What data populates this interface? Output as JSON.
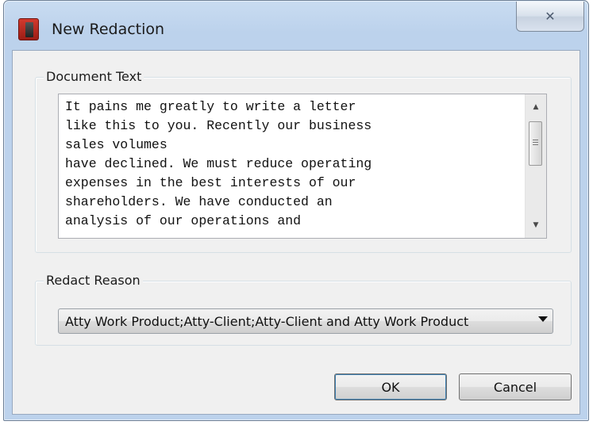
{
  "window": {
    "title": "New Redaction",
    "close_symbol": "✕"
  },
  "document_text_group": {
    "label": "Document Text",
    "text": "It pains me greatly to write a letter\nlike this to you.  Recently our business\nsales volumes\nhave declined.  We must reduce operating\nexpenses in the best interests of our\nshareholders.  We have conducted an\nanalysis of our operations and"
  },
  "redact_reason_group": {
    "label": "Redact Reason",
    "selected_value": "Atty Work Product;Atty-Client;Atty-Client and Atty Work Product"
  },
  "buttons": {
    "ok_label": "OK",
    "cancel_label": "Cancel"
  },
  "icons": {
    "app": "redaction-app-icon",
    "close": "close-icon",
    "scroll_up": "scroll-up-arrow-icon",
    "scroll_down": "scroll-down-arrow-icon",
    "dropdown": "chevron-down-icon"
  },
  "colors": {
    "title_bar": "#bcd2ec",
    "dialog_background": "#f0f0f0",
    "app_icon": "#c2302a"
  }
}
